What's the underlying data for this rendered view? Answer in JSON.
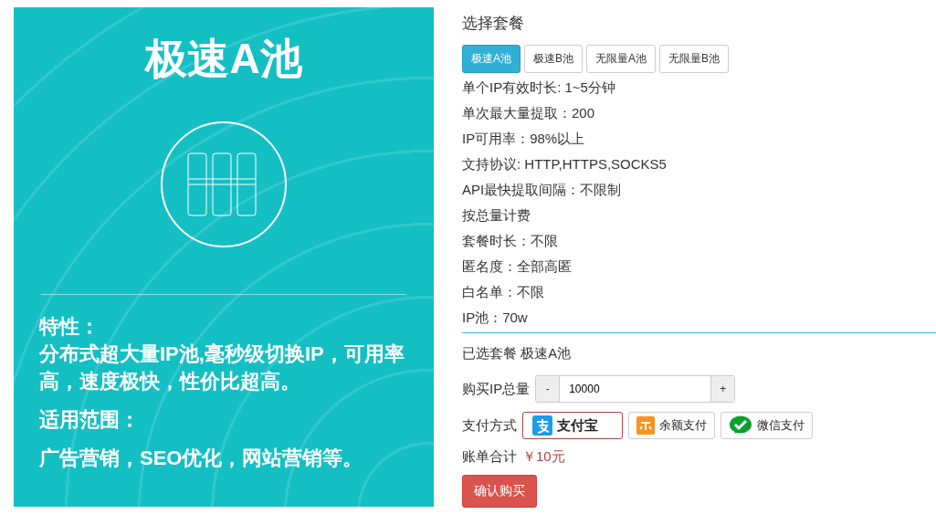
{
  "banner": {
    "title": "极速A池",
    "features_heading": "特性：",
    "features_text": "分布式超大量IP池,毫秒级切换IP，可用率高，速度极快，性价比超高。",
    "scope_heading": "适用范围：",
    "scope_text": "广告营销，SEO优化，网站营销等。"
  },
  "plan_heading": "选择套餐",
  "plans": [
    {
      "label": "极速A池",
      "selected": true
    },
    {
      "label": "极速B池",
      "selected": false
    },
    {
      "label": "无限量A池",
      "selected": false
    },
    {
      "label": "无限量B池",
      "selected": false
    }
  ],
  "specs": [
    "单个IP有效时长: 1~5分钟",
    "单次最大量提取：200",
    "IP可用率：98%以上",
    "文持协议: HTTP,HTTPS,SOCKS5",
    "API最快提取间隔：不限制",
    "按总量计费",
    "套餐时长：不限",
    "匿名度：全部高匿",
    "白名单：不限",
    "IP池：70w"
  ],
  "selected_plan": {
    "label": "已选套餐",
    "value": "极速A池"
  },
  "quantity": {
    "label": "购买IP总量",
    "minus": "-",
    "value": "10000",
    "plus": "+"
  },
  "payment": {
    "label": "支付方式",
    "methods": [
      {
        "kind": "alipay",
        "label": "支付宝",
        "selected": true
      },
      {
        "kind": "balance",
        "label": "余额支付",
        "selected": false
      },
      {
        "kind": "wechat",
        "label": "微信支付",
        "selected": false
      }
    ]
  },
  "total": {
    "label": "账单合计",
    "value": "￥10元"
  },
  "confirm_button": "确认购买"
}
